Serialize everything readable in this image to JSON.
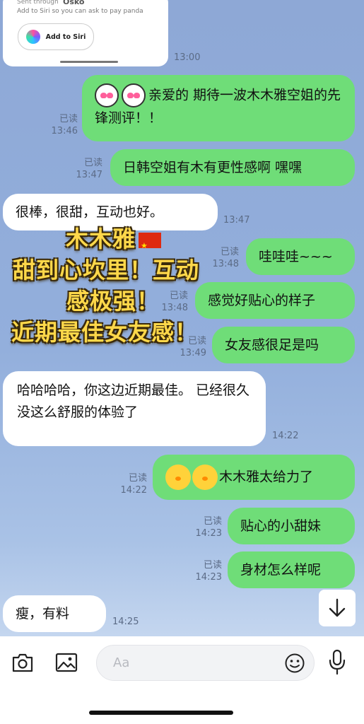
{
  "siri_card": {
    "sent_through": "Sent through",
    "brand": "Osko",
    "hint": "Add to Siri so you can ask to pay panda",
    "button_label": "Add to Siri",
    "time": "13:00"
  },
  "messages": [
    {
      "side": "right",
      "read": "已读",
      "time": "13:46",
      "text": "亲爱的 期待一波木木雅空姐的先锋测评！！",
      "emoji": "heart-eyes-face x2"
    },
    {
      "side": "right",
      "read": "已读",
      "time": "13:47",
      "text": "日韩空姐有木有更性感啊 嘿嘿"
    },
    {
      "side": "left",
      "time": "13:47",
      "text": "很棒，很甜，互动也好。"
    },
    {
      "side": "right",
      "read": "已读",
      "time": "13:48",
      "text": "哇哇哇~~~"
    },
    {
      "side": "right",
      "read": "已读",
      "time": "13:48",
      "text": "感觉好贴心的样子"
    },
    {
      "side": "right",
      "read": "已读",
      "time": "13:49",
      "text": "女友感很足是吗"
    },
    {
      "side": "left",
      "time": "14:22",
      "text": "哈哈哈哈，你这边近期最佳。 已经很久没这么舒服的体验了"
    },
    {
      "side": "right",
      "read": "已读",
      "time": "14:22",
      "text": "木木雅太给力了",
      "emoji": "chick x2"
    },
    {
      "side": "right",
      "read": "已读",
      "time": "14:23",
      "text": "贴心的小甜妹"
    },
    {
      "side": "right",
      "read": "已读",
      "time": "14:23",
      "text": "身材怎么样呢"
    },
    {
      "side": "left",
      "time": "14:25",
      "text": "瘦，有料"
    }
  ],
  "overlay": {
    "line1": "木木雅",
    "line2": "甜到心坎里！互动",
    "line3": "感极强！",
    "line4": "近期最佳女友感！",
    "colors": {
      "fill": "#ffd84a",
      "stroke": "#3a2a0a"
    }
  },
  "input": {
    "placeholder": "Aa"
  },
  "icons": [
    "camera-icon",
    "image-icon",
    "emoji-icon",
    "microphone-icon",
    "arrow-down-icon"
  ],
  "colors": {
    "green_bubble": "#6fdd78",
    "white_bubble": "#ffffff",
    "background": "#8fabd9"
  }
}
